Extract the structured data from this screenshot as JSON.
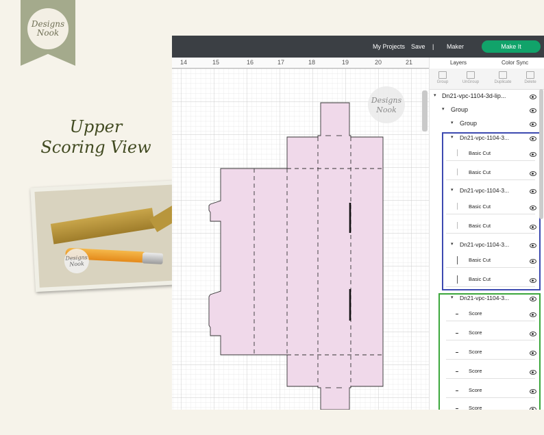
{
  "branding": {
    "logo_top": "Designs",
    "logo_bottom": "Nook",
    "watermark_top": "Designs",
    "watermark_bottom": "Nook",
    "photo_watermark_top": "Designs",
    "photo_watermark_bottom": "Nook"
  },
  "headline": {
    "line1": "Upper",
    "line2": "Scoring View"
  },
  "topbar": {
    "my_projects": "My Projects",
    "save": "Save",
    "separator": "|",
    "maker": "Maker",
    "make_it": "Make It"
  },
  "ruler": {
    "ticks": [
      "14",
      "15",
      "16",
      "17",
      "18",
      "19",
      "20",
      "21"
    ]
  },
  "panel": {
    "tabs": [
      "Layers",
      "Color Sync"
    ],
    "tools": [
      "Group",
      "UnGroup",
      "Duplicate",
      "Delete"
    ],
    "layers": [
      {
        "label": "Dn21-vpc-1104-3d-lip...",
        "kind": "root"
      },
      {
        "label": "Group",
        "kind": "group"
      },
      {
        "label": "Group",
        "kind": "group2"
      },
      {
        "label": "Dn21-vpc-1104-3...",
        "kind": "sub"
      },
      {
        "label": "Basic Cut",
        "kind": "item"
      },
      {
        "label": "Basic Cut",
        "kind": "item"
      },
      {
        "label": "Dn21-vpc-1104-3...",
        "kind": "sub"
      },
      {
        "label": "Basic Cut",
        "kind": "item"
      },
      {
        "label": "Basic Cut",
        "kind": "item"
      },
      {
        "label": "Dn21-vpc-1104-3...",
        "kind": "sub"
      },
      {
        "label": "Basic Cut",
        "kind": "item"
      },
      {
        "label": "Basic Cut",
        "kind": "item"
      },
      {
        "label": "Dn21-vpc-1104-3...",
        "kind": "sub"
      },
      {
        "label": "Score",
        "kind": "score"
      },
      {
        "label": "Score",
        "kind": "score"
      },
      {
        "label": "Score",
        "kind": "score"
      },
      {
        "label": "Score",
        "kind": "score"
      },
      {
        "label": "Score",
        "kind": "score"
      },
      {
        "label": "Score",
        "kind": "score"
      }
    ]
  },
  "colors": {
    "topbar": "#3b3f44",
    "make_it": "#11a36a",
    "dieline_fill": "#f0d9ea",
    "blue_selection": "#3c49b0",
    "green_selection": "#3aa63a"
  }
}
